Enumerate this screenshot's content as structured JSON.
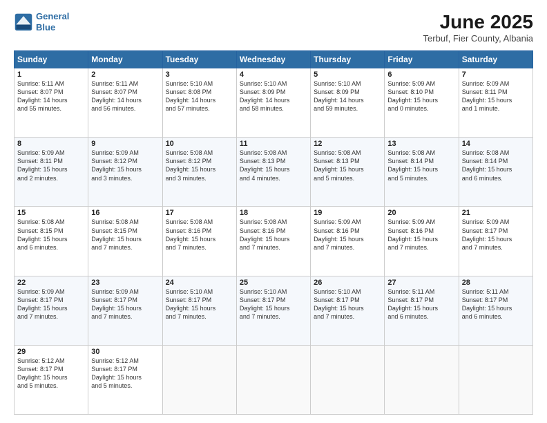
{
  "logo": {
    "line1": "General",
    "line2": "Blue"
  },
  "title": "June 2025",
  "subtitle": "Terbuf, Fier County, Albania",
  "weekdays": [
    "Sunday",
    "Monday",
    "Tuesday",
    "Wednesday",
    "Thursday",
    "Friday",
    "Saturday"
  ],
  "weeks": [
    [
      {
        "day": "1",
        "info": "Sunrise: 5:11 AM\nSunset: 8:07 PM\nDaylight: 14 hours\nand 55 minutes."
      },
      {
        "day": "2",
        "info": "Sunrise: 5:11 AM\nSunset: 8:07 PM\nDaylight: 14 hours\nand 56 minutes."
      },
      {
        "day": "3",
        "info": "Sunrise: 5:10 AM\nSunset: 8:08 PM\nDaylight: 14 hours\nand 57 minutes."
      },
      {
        "day": "4",
        "info": "Sunrise: 5:10 AM\nSunset: 8:09 PM\nDaylight: 14 hours\nand 58 minutes."
      },
      {
        "day": "5",
        "info": "Sunrise: 5:10 AM\nSunset: 8:09 PM\nDaylight: 14 hours\nand 59 minutes."
      },
      {
        "day": "6",
        "info": "Sunrise: 5:09 AM\nSunset: 8:10 PM\nDaylight: 15 hours\nand 0 minutes."
      },
      {
        "day": "7",
        "info": "Sunrise: 5:09 AM\nSunset: 8:11 PM\nDaylight: 15 hours\nand 1 minute."
      }
    ],
    [
      {
        "day": "8",
        "info": "Sunrise: 5:09 AM\nSunset: 8:11 PM\nDaylight: 15 hours\nand 2 minutes."
      },
      {
        "day": "9",
        "info": "Sunrise: 5:09 AM\nSunset: 8:12 PM\nDaylight: 15 hours\nand 3 minutes."
      },
      {
        "day": "10",
        "info": "Sunrise: 5:08 AM\nSunset: 8:12 PM\nDaylight: 15 hours\nand 3 minutes."
      },
      {
        "day": "11",
        "info": "Sunrise: 5:08 AM\nSunset: 8:13 PM\nDaylight: 15 hours\nand 4 minutes."
      },
      {
        "day": "12",
        "info": "Sunrise: 5:08 AM\nSunset: 8:13 PM\nDaylight: 15 hours\nand 5 minutes."
      },
      {
        "day": "13",
        "info": "Sunrise: 5:08 AM\nSunset: 8:14 PM\nDaylight: 15 hours\nand 5 minutes."
      },
      {
        "day": "14",
        "info": "Sunrise: 5:08 AM\nSunset: 8:14 PM\nDaylight: 15 hours\nand 6 minutes."
      }
    ],
    [
      {
        "day": "15",
        "info": "Sunrise: 5:08 AM\nSunset: 8:15 PM\nDaylight: 15 hours\nand 6 minutes."
      },
      {
        "day": "16",
        "info": "Sunrise: 5:08 AM\nSunset: 8:15 PM\nDaylight: 15 hours\nand 7 minutes."
      },
      {
        "day": "17",
        "info": "Sunrise: 5:08 AM\nSunset: 8:16 PM\nDaylight: 15 hours\nand 7 minutes."
      },
      {
        "day": "18",
        "info": "Sunrise: 5:08 AM\nSunset: 8:16 PM\nDaylight: 15 hours\nand 7 minutes."
      },
      {
        "day": "19",
        "info": "Sunrise: 5:09 AM\nSunset: 8:16 PM\nDaylight: 15 hours\nand 7 minutes."
      },
      {
        "day": "20",
        "info": "Sunrise: 5:09 AM\nSunset: 8:16 PM\nDaylight: 15 hours\nand 7 minutes."
      },
      {
        "day": "21",
        "info": "Sunrise: 5:09 AM\nSunset: 8:17 PM\nDaylight: 15 hours\nand 7 minutes."
      }
    ],
    [
      {
        "day": "22",
        "info": "Sunrise: 5:09 AM\nSunset: 8:17 PM\nDaylight: 15 hours\nand 7 minutes."
      },
      {
        "day": "23",
        "info": "Sunrise: 5:09 AM\nSunset: 8:17 PM\nDaylight: 15 hours\nand 7 minutes."
      },
      {
        "day": "24",
        "info": "Sunrise: 5:10 AM\nSunset: 8:17 PM\nDaylight: 15 hours\nand 7 minutes."
      },
      {
        "day": "25",
        "info": "Sunrise: 5:10 AM\nSunset: 8:17 PM\nDaylight: 15 hours\nand 7 minutes."
      },
      {
        "day": "26",
        "info": "Sunrise: 5:10 AM\nSunset: 8:17 PM\nDaylight: 15 hours\nand 7 minutes."
      },
      {
        "day": "27",
        "info": "Sunrise: 5:11 AM\nSunset: 8:17 PM\nDaylight: 15 hours\nand 6 minutes."
      },
      {
        "day": "28",
        "info": "Sunrise: 5:11 AM\nSunset: 8:17 PM\nDaylight: 15 hours\nand 6 minutes."
      }
    ],
    [
      {
        "day": "29",
        "info": "Sunrise: 5:12 AM\nSunset: 8:17 PM\nDaylight: 15 hours\nand 5 minutes."
      },
      {
        "day": "30",
        "info": "Sunrise: 5:12 AM\nSunset: 8:17 PM\nDaylight: 15 hours\nand 5 minutes."
      },
      {
        "day": "",
        "info": ""
      },
      {
        "day": "",
        "info": ""
      },
      {
        "day": "",
        "info": ""
      },
      {
        "day": "",
        "info": ""
      },
      {
        "day": "",
        "info": ""
      }
    ]
  ]
}
